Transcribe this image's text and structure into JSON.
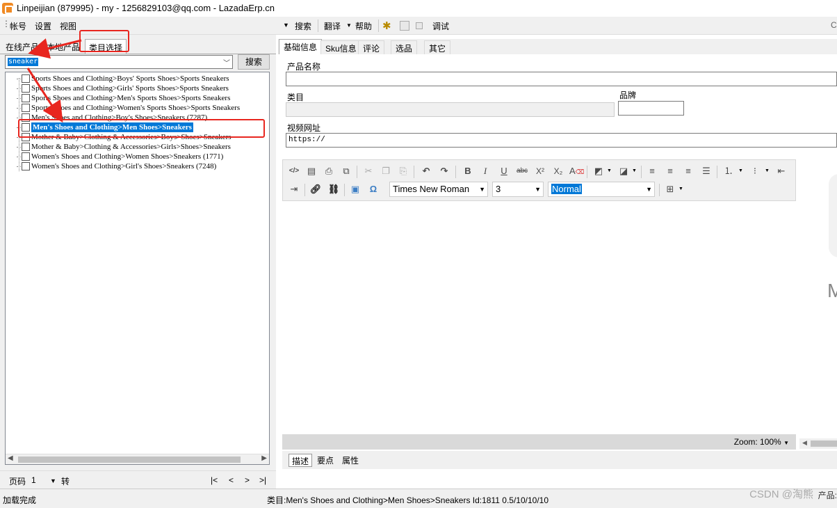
{
  "window": {
    "title": "Linpeijian (879995) - my - 1256829103@qq.com - LazadaErp.cn"
  },
  "menu": {
    "account": "帐号",
    "settings": "设置",
    "view": "视图",
    "search": "搜索",
    "translate": "翻译",
    "help": "帮助",
    "debug": "调试",
    "right_edge": "C"
  },
  "left": {
    "tabs": [
      "在线产品",
      "本地产品",
      "类目选择"
    ],
    "search": {
      "value": "sneaker",
      "button": "搜索"
    },
    "tree_items": [
      {
        "label": "Sports Shoes and Clothing>Boys' Sports Shoes>Sports Sneakers",
        "selected": false
      },
      {
        "label": "Sports Shoes and Clothing>Girls' Sports Shoes>Sports Sneakers",
        "selected": false
      },
      {
        "label": "Sports Shoes and Clothing>Men's Sports Shoes>Sports Sneakers",
        "selected": false
      },
      {
        "label": "Sports Shoes and Clothing>Women's Sports Shoes>Sports Sneakers",
        "selected": false
      },
      {
        "label": "Men's Shoes and Clothing>Boy's Shoes>Sneakers (7287)",
        "selected": false
      },
      {
        "label": "Men's Shoes and Clothing>Men Shoes>Sneakers",
        "selected": true
      },
      {
        "label": "Mother & Baby>Clothing & Accessories>Boys>Shoes>Sneakers",
        "selected": false
      },
      {
        "label": "Mother & Baby>Clothing & Accessories>Girls>Shoes>Sneakers",
        "selected": false
      },
      {
        "label": "Women's Shoes and Clothing>Women Shoes>Sneakers (1771)",
        "selected": false
      },
      {
        "label": "Women's Shoes and Clothing>Girl's Shoes>Sneakers (7248)",
        "selected": false
      }
    ],
    "pager": {
      "label": "页码",
      "page": "1",
      "go": "转",
      "first": "|<",
      "prev": "<",
      "next": ">",
      "last": ">|"
    }
  },
  "right": {
    "tabs": [
      "基础信息",
      "Sku信息",
      "评论",
      "选品",
      "其它"
    ],
    "fields": {
      "product_name_label": "产品名称",
      "category_label": "类目",
      "brand_label": "品牌",
      "video_url_label": "视频网址",
      "video_url_value": "https://"
    },
    "editor": {
      "font": "Times New Roman",
      "size": "3",
      "format": "Normal",
      "zoom": "Zoom: 100%"
    },
    "bottom_tabs": [
      "描述",
      "要点",
      "属性"
    ],
    "side_watermark": "M"
  },
  "status": {
    "left": "加载完成",
    "center": "类目:Men's Shoes and Clothing>Men Shoes>Sneakers Id:1811  0.5/10/10/10",
    "watermark": "CSDN @淘熊",
    "right": "产品:"
  },
  "colors": {
    "selection": "#0078d7",
    "annotation": "#e8261f",
    "app_icon": "#f08a24"
  }
}
